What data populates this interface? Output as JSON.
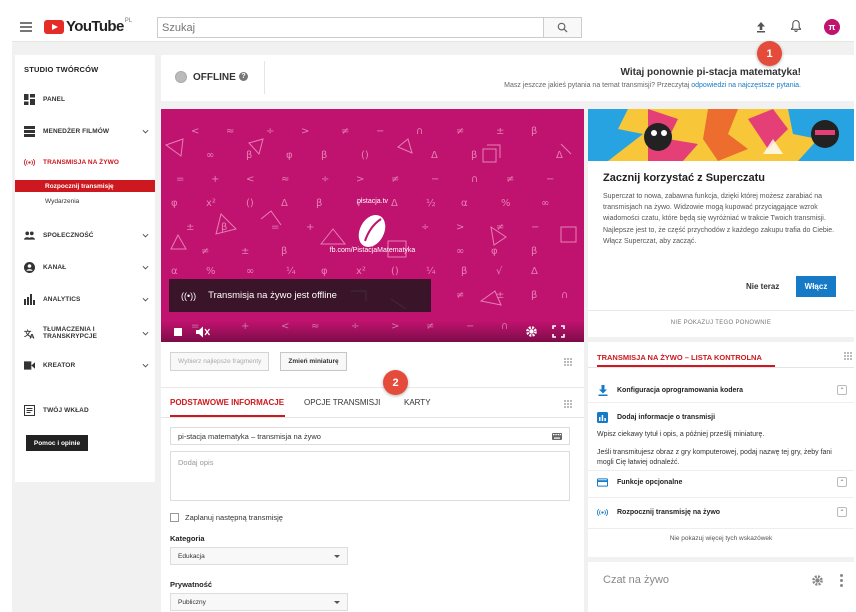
{
  "header": {
    "logo_text": "YouTube",
    "logo_region": "PL",
    "search_placeholder": "Szukaj",
    "avatar_letter": "π"
  },
  "sidebar": {
    "title": "STUDIO TWÓRCÓW",
    "items": [
      {
        "label": "PANEL",
        "icon": "dashboard-icon"
      },
      {
        "label": "MENEDŻER FILMÓW",
        "icon": "video-manager-icon"
      },
      {
        "label": "TRANSMISJA NA ŻYWO",
        "icon": "live-icon"
      },
      {
        "label": "SPOŁECZNOŚĆ",
        "icon": "community-icon"
      },
      {
        "label": "KANAŁ",
        "icon": "channel-icon"
      },
      {
        "label": "ANALYTICS",
        "icon": "analytics-icon"
      },
      {
        "label": "TŁUMACZENIA I TRANSKRYPCJE",
        "icon": "translate-icon"
      },
      {
        "label": "KREATOR",
        "icon": "creator-icon"
      },
      {
        "label": "TWÓJ WKŁAD",
        "icon": "contribution-icon"
      }
    ],
    "sub_items": [
      "Rozpocznij transmisję",
      "Wydarzenia"
    ],
    "help_button": "Pomoc i opinie"
  },
  "status": {
    "label": "OFFLINE",
    "welcome": "Witaj ponownie pi-stacja matematyka!",
    "question_text": "Masz jeszcze jakieś pytania na temat transmisji? Przeczytaj",
    "question_link": "odpowiedzi na najczęstsze pytania",
    "question_end": "."
  },
  "video": {
    "site_text": "pistacja.tv",
    "fb_text": "fb.com/PistacjaMatematyka",
    "overlay_text": "Transmisja na żywo jest offline",
    "btn_highlights": "Wybierz najlepsze fragmenty",
    "btn_thumbnail": "Zmień miniaturę"
  },
  "info": {
    "tabs": [
      "PODSTAWOWE INFORMACJE",
      "OPCJE TRANSMISJI",
      "KARTY"
    ],
    "title_value": "pi-stacja matematyka – transmisja na żywo",
    "description_placeholder": "Dodaj opis",
    "schedule_label": "Zaplanuj następną transmisję",
    "category_label": "Kategoria",
    "category_value": "Edukacja",
    "privacy_label": "Prywatność",
    "privacy_value": "Publiczny"
  },
  "superchat": {
    "title": "Zacznij korzystać z Superczatu",
    "text": "Superczat to nowa, zabawna funkcja, dzięki której możesz zarabiać na transmisjach na żywo. Widzowie mogą kupować przyciągające wzrok wiadomości czatu, które będą się wyróżniać w trakcie Twoich transmisji. Najlepsze jest to, że część przychodów z każdego zakupu trafia do Ciebie. Włącz Superczat, aby zacząć.",
    "later": "Nie teraz",
    "enable": "Włącz",
    "dont_show": "NIE POKAZUJ TEGO PONOWNIE"
  },
  "checklist": {
    "title": "TRANSMISJA NA ŻYWO – LISTA KONTROLNA",
    "items": [
      {
        "label": "Konfiguracja oprogramowania kodera",
        "icon": "download-icon"
      },
      {
        "label": "Dodaj informacje o transmisji",
        "icon": "info-chart-icon"
      },
      {
        "label": "Funkcje opcjonalne",
        "icon": "card-icon"
      },
      {
        "label": "Rozpocznij transmisję na żywo",
        "icon": "live-icon"
      }
    ],
    "desc1": "Wpisz ciekawy tytuł i opis, a później prześlij miniaturę.",
    "desc2": "Jeśli transmitujesz obraz z gry komputerowej, podaj nazwę tej gry, żeby fani mogli Cię łatwiej odnaleźć.",
    "footer": "Nie pokazuj więcej tych wskazówek"
  },
  "chat": {
    "label": "Czat na żywo"
  },
  "callouts": [
    "1",
    "2"
  ],
  "colors": {
    "brand_red": "#cc181e",
    "video_bg": "#c0126f",
    "link_blue": "#167ac6",
    "callout": "#e44b3b"
  }
}
